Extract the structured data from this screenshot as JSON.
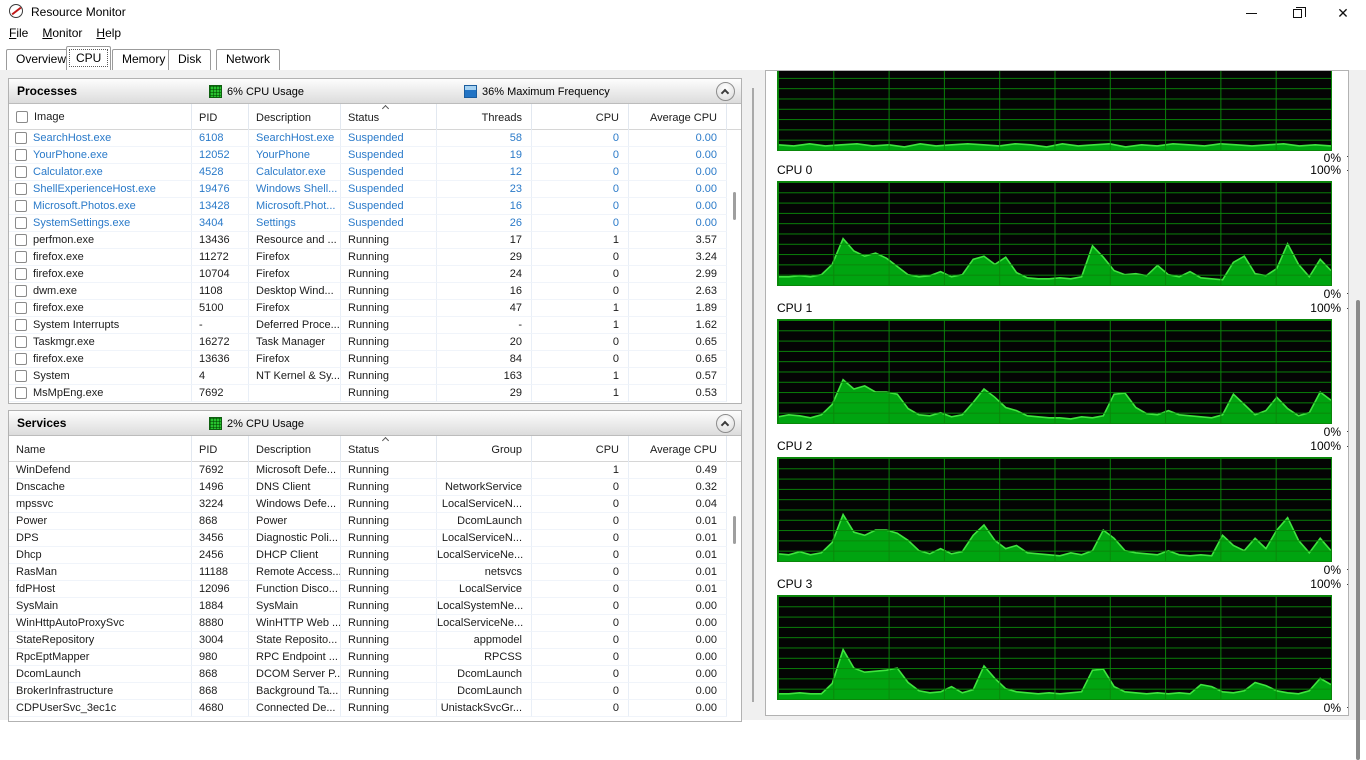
{
  "window": {
    "title": "Resource Monitor"
  },
  "menu": {
    "items": [
      "File",
      "Monitor",
      "Help"
    ]
  },
  "tabs": {
    "items": [
      "Overview",
      "CPU",
      "Memory",
      "Disk",
      "Network"
    ],
    "selected": "CPU"
  },
  "icons": {
    "close_glyph": "✕"
  },
  "processes": {
    "title": "Processes",
    "legend": [
      {
        "label": "6% CPU Usage",
        "icon": "cpu-usage-legend-icon",
        "color": "#27c22f"
      },
      {
        "label": "36% Maximum Frequency",
        "icon": "max-frequency-legend-icon",
        "color": "#2374c4"
      }
    ],
    "columns": [
      "Image",
      "PID",
      "Description",
      "Status",
      "Threads",
      "CPU",
      "Average CPU"
    ],
    "rows": [
      {
        "suspended": true,
        "cells": [
          "SearchHost.exe",
          "6108",
          "SearchHost.exe",
          "Suspended",
          "58",
          "0",
          "0.00"
        ]
      },
      {
        "suspended": true,
        "cells": [
          "YourPhone.exe",
          "12052",
          "YourPhone",
          "Suspended",
          "19",
          "0",
          "0.00"
        ]
      },
      {
        "suspended": true,
        "cells": [
          "Calculator.exe",
          "4528",
          "Calculator.exe",
          "Suspended",
          "12",
          "0",
          "0.00"
        ]
      },
      {
        "suspended": true,
        "cells": [
          "ShellExperienceHost.exe",
          "19476",
          "Windows Shell...",
          "Suspended",
          "23",
          "0",
          "0.00"
        ]
      },
      {
        "suspended": true,
        "cells": [
          "Microsoft.Photos.exe",
          "13428",
          "Microsoft.Phot...",
          "Suspended",
          "16",
          "0",
          "0.00"
        ]
      },
      {
        "suspended": true,
        "cells": [
          "SystemSettings.exe",
          "3404",
          "Settings",
          "Suspended",
          "26",
          "0",
          "0.00"
        ]
      },
      {
        "suspended": false,
        "cells": [
          "perfmon.exe",
          "13436",
          "Resource and ...",
          "Running",
          "17",
          "1",
          "3.57"
        ]
      },
      {
        "suspended": false,
        "cells": [
          "firefox.exe",
          "11272",
          "Firefox",
          "Running",
          "29",
          "0",
          "3.24"
        ]
      },
      {
        "suspended": false,
        "cells": [
          "firefox.exe",
          "10704",
          "Firefox",
          "Running",
          "24",
          "0",
          "2.99"
        ]
      },
      {
        "suspended": false,
        "cells": [
          "dwm.exe",
          "1108",
          "Desktop Wind...",
          "Running",
          "16",
          "0",
          "2.63"
        ]
      },
      {
        "suspended": false,
        "cells": [
          "firefox.exe",
          "5100",
          "Firefox",
          "Running",
          "47",
          "1",
          "1.89"
        ]
      },
      {
        "suspended": false,
        "cells": [
          "System Interrupts",
          "-",
          "Deferred Proce...",
          "Running",
          "-",
          "1",
          "1.62"
        ]
      },
      {
        "suspended": false,
        "cells": [
          "Taskmgr.exe",
          "16272",
          "Task Manager",
          "Running",
          "20",
          "0",
          "0.65"
        ]
      },
      {
        "suspended": false,
        "cells": [
          "firefox.exe",
          "13636",
          "Firefox",
          "Running",
          "84",
          "0",
          "0.65"
        ]
      },
      {
        "suspended": false,
        "cells": [
          "System",
          "4",
          "NT Kernel & Sy...",
          "Running",
          "163",
          "1",
          "0.57"
        ]
      },
      {
        "suspended": false,
        "cells": [
          "MsMpEng.exe",
          "7692",
          "",
          "Running",
          "29",
          "1",
          "0.53"
        ]
      }
    ]
  },
  "services": {
    "title": "Services",
    "legend": [
      {
        "label": "2% CPU Usage",
        "icon": "cpu-usage-legend-icon",
        "color": "#27c22f"
      }
    ],
    "columns": [
      "Name",
      "PID",
      "Description",
      "Status",
      "Group",
      "CPU",
      "Average CPU"
    ],
    "rows": [
      {
        "cells": [
          "WinDefend",
          "7692",
          "Microsoft Defe...",
          "Running",
          "",
          "1",
          "0.49"
        ]
      },
      {
        "cells": [
          "Dnscache",
          "1496",
          "DNS Client",
          "Running",
          "NetworkService",
          "0",
          "0.32"
        ]
      },
      {
        "cells": [
          "mpssvc",
          "3224",
          "Windows Defe...",
          "Running",
          "LocalServiceN...",
          "0",
          "0.04"
        ]
      },
      {
        "cells": [
          "Power",
          "868",
          "Power",
          "Running",
          "DcomLaunch",
          "0",
          "0.01"
        ]
      },
      {
        "cells": [
          "DPS",
          "3456",
          "Diagnostic Poli...",
          "Running",
          "LocalServiceN...",
          "0",
          "0.01"
        ]
      },
      {
        "cells": [
          "Dhcp",
          "2456",
          "DHCP Client",
          "Running",
          "LocalServiceNe...",
          "0",
          "0.01"
        ]
      },
      {
        "cells": [
          "RasMan",
          "11188",
          "Remote Access...",
          "Running",
          "netsvcs",
          "0",
          "0.01"
        ]
      },
      {
        "cells": [
          "fdPHost",
          "12096",
          "Function Disco...",
          "Running",
          "LocalService",
          "0",
          "0.01"
        ]
      },
      {
        "cells": [
          "SysMain",
          "1884",
          "SysMain",
          "Running",
          "LocalSystemNe...",
          "0",
          "0.00"
        ]
      },
      {
        "cells": [
          "WinHttpAutoProxySvc",
          "8880",
          "WinHTTP Web ...",
          "Running",
          "LocalServiceNe...",
          "0",
          "0.00"
        ]
      },
      {
        "cells": [
          "StateRepository",
          "3004",
          "State Reposito...",
          "Running",
          "appmodel",
          "0",
          "0.00"
        ]
      },
      {
        "cells": [
          "RpcEptMapper",
          "980",
          "RPC Endpoint ...",
          "Running",
          "RPCSS",
          "0",
          "0.00"
        ]
      },
      {
        "cells": [
          "DcomLaunch",
          "868",
          "DCOM Server P...",
          "Running",
          "DcomLaunch",
          "0",
          "0.00"
        ]
      },
      {
        "cells": [
          "BrokerInfrastructure",
          "868",
          "Background Ta...",
          "Running",
          "DcomLaunch",
          "0",
          "0.00"
        ]
      },
      {
        "cells": [
          "CDPUserSvc_3ec1c",
          "4680",
          "Connected De...",
          "Running",
          "UnistackSvcGr...",
          "0",
          "0.00"
        ]
      }
    ]
  },
  "chart_data": [
    {
      "type": "area",
      "id": "cpu-total-partial",
      "label": "",
      "ymax_label": "",
      "ymin_label": "0%",
      "ylim": [
        0,
        100
      ],
      "grid": "10x10",
      "colors": {
        "fill": "#00a410",
        "line": "#3fe43f",
        "grid": "#0a870a",
        "bg": "#040404"
      },
      "values": [
        5,
        4,
        6,
        4,
        5,
        6,
        4,
        5,
        3,
        6,
        4,
        5,
        6,
        5,
        4,
        6,
        5,
        3,
        6,
        4,
        5,
        6,
        3,
        5,
        4,
        6,
        5,
        4,
        6,
        5,
        4,
        5,
        6,
        4,
        5,
        4
      ]
    },
    {
      "type": "area",
      "id": "cpu0",
      "label": "CPU 0",
      "ymax_label": "100%",
      "ymin_label": "0%",
      "ylim": [
        0,
        100
      ],
      "grid": "10x10",
      "colors": {
        "fill": "#00a410",
        "line": "#3fe43f",
        "grid": "#0a870a",
        "bg": "#040404"
      },
      "values": [
        8,
        8,
        9,
        8,
        10,
        20,
        45,
        33,
        28,
        31,
        26,
        18,
        10,
        8,
        9,
        13,
        8,
        10,
        25,
        28,
        20,
        27,
        12,
        7,
        6,
        6,
        7,
        6,
        8,
        38,
        27,
        14,
        10,
        11,
        9,
        19,
        10,
        8,
        13,
        7,
        6,
        5,
        22,
        28,
        11,
        9,
        16,
        40,
        20,
        8,
        25,
        14
      ]
    },
    {
      "type": "area",
      "id": "cpu1",
      "label": "CPU 1",
      "ymax_label": "100%",
      "ymin_label": "0%",
      "ylim": [
        0,
        100
      ],
      "grid": "10x10",
      "colors": {
        "fill": "#00a410",
        "line": "#3fe43f",
        "grid": "#0a870a",
        "bg": "#040404"
      },
      "values": [
        6,
        8,
        7,
        5,
        8,
        18,
        42,
        33,
        36,
        30,
        30,
        28,
        14,
        8,
        7,
        10,
        6,
        8,
        20,
        33,
        25,
        15,
        12,
        7,
        6,
        5,
        5,
        4,
        6,
        5,
        7,
        28,
        29,
        15,
        9,
        8,
        12,
        8,
        7,
        6,
        5,
        8,
        28,
        18,
        8,
        12,
        25,
        14,
        7,
        10,
        30,
        22
      ]
    },
    {
      "type": "area",
      "id": "cpu2",
      "label": "CPU 2",
      "ymax_label": "100%",
      "ymin_label": "0%",
      "ylim": [
        0,
        100
      ],
      "grid": "10x10",
      "colors": {
        "fill": "#00a410",
        "line": "#3fe43f",
        "grid": "#0a870a",
        "bg": "#040404"
      },
      "values": [
        7,
        6,
        9,
        6,
        8,
        18,
        45,
        28,
        25,
        30,
        30,
        27,
        20,
        10,
        7,
        12,
        7,
        9,
        25,
        35,
        20,
        12,
        15,
        8,
        7,
        6,
        5,
        8,
        6,
        10,
        30,
        22,
        10,
        8,
        7,
        6,
        10,
        6,
        5,
        6,
        5,
        25,
        15,
        10,
        22,
        12,
        30,
        42,
        20,
        8,
        22,
        10
      ]
    },
    {
      "type": "area",
      "id": "cpu3",
      "label": "CPU 3",
      "ymax_label": "100%",
      "ymin_label": "0%",
      "ylim": [
        0,
        100
      ],
      "grid": "10x10",
      "colors": {
        "fill": "#00a410",
        "line": "#3fe43f",
        "grid": "#0a870a",
        "bg": "#040404"
      },
      "values": [
        5,
        5,
        6,
        5,
        5,
        15,
        48,
        30,
        26,
        27,
        28,
        30,
        16,
        8,
        6,
        7,
        12,
        6,
        9,
        32,
        20,
        10,
        7,
        6,
        5,
        6,
        5,
        6,
        7,
        28,
        29,
        12,
        7,
        6,
        5,
        6,
        5,
        6,
        5,
        14,
        12,
        7,
        6,
        8,
        16,
        13,
        8,
        6,
        5,
        8,
        20,
        14
      ]
    }
  ]
}
